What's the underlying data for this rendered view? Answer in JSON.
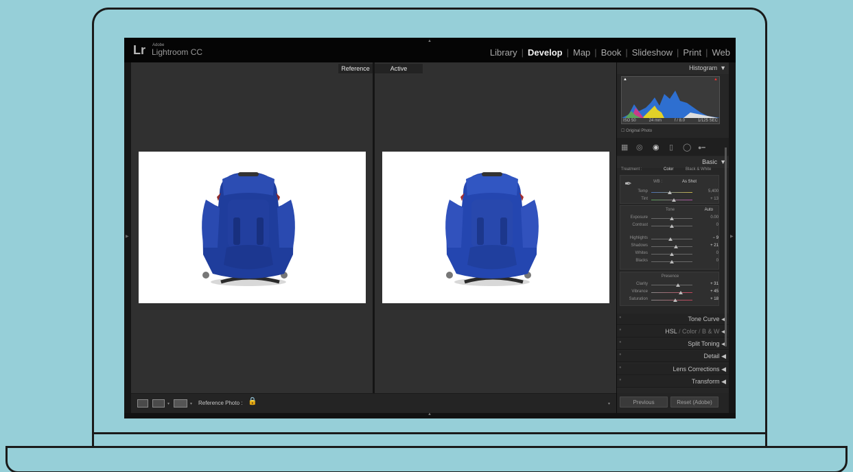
{
  "app": {
    "logo_short": "Lr",
    "logo_vendor": "Adobe",
    "logo_name": "Lightroom CC"
  },
  "modules": [
    {
      "label": "Library",
      "active": false
    },
    {
      "label": "Develop",
      "active": true
    },
    {
      "label": "Map",
      "active": false
    },
    {
      "label": "Book",
      "active": false
    },
    {
      "label": "Slideshow",
      "active": false
    },
    {
      "label": "Print",
      "active": false
    },
    {
      "label": "Web",
      "active": false
    }
  ],
  "compare": {
    "reference_label": "Reference",
    "active_label": "Active"
  },
  "toolbar": {
    "reference_photo_label": "Reference Photo :"
  },
  "panel": {
    "histogram_title": "Histogram",
    "histogram_info": [
      "ISO 50",
      "24 mm",
      "f / 8.0",
      "1/125 SEC"
    ],
    "original_photo_label": "Original Photo",
    "basic_title": "Basic",
    "treatment_label": "Treatment :",
    "treatment_color": "Color",
    "treatment_bw": "Black & White",
    "wb_label": "WB :",
    "wb_value": "As Shot",
    "temp": {
      "label": "Temp",
      "value": "5,400",
      "pos": 0.45
    },
    "tint": {
      "label": "Tint",
      "value": "+ 13",
      "pos": 0.55
    },
    "tone_title": "Tone",
    "tone_auto": "Auto",
    "exposure": {
      "label": "Exposure",
      "value": "0.00",
      "pos": 0.5
    },
    "contrast": {
      "label": "Contrast",
      "value": "0",
      "pos": 0.5
    },
    "highlights": {
      "label": "Highlights",
      "value": "− 9",
      "pos": 0.46
    },
    "shadows": {
      "label": "Shadows",
      "value": "+ 21",
      "pos": 0.6
    },
    "whites": {
      "label": "Whites",
      "value": "0",
      "pos": 0.5
    },
    "blacks": {
      "label": "Blacks",
      "value": "0",
      "pos": 0.5
    },
    "presence_title": "Presence",
    "clarity": {
      "label": "Clarity",
      "value": "+ 31",
      "pos": 0.65
    },
    "vibrance": {
      "label": "Vibrance",
      "value": "+ 45",
      "pos": 0.72
    },
    "saturation": {
      "label": "Saturation",
      "value": "+ 18",
      "pos": 0.58
    },
    "tone_curve": "Tone Curve",
    "hsl_color_bw": [
      "HSL",
      "Color",
      "B & W"
    ],
    "split_toning": "Split Toning",
    "detail": "Detail",
    "lens_corrections": "Lens Corrections",
    "transform": "Transform",
    "previous_button": "Previous",
    "reset_button": "Reset (Adobe)"
  }
}
